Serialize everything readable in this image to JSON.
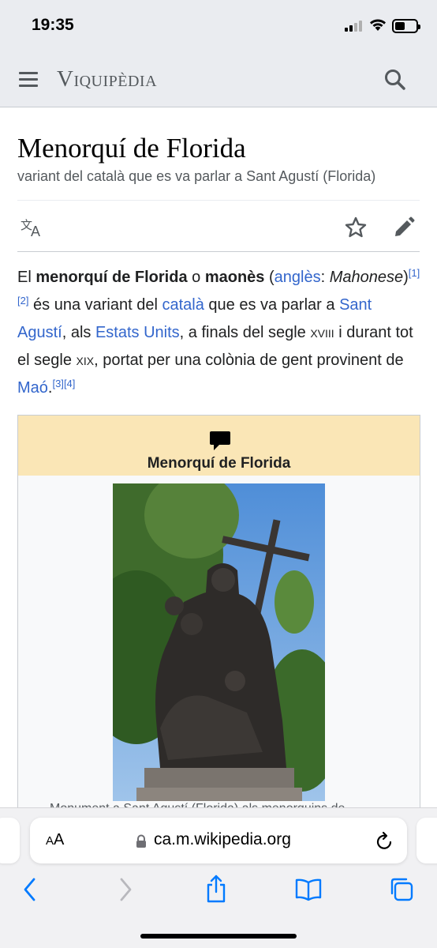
{
  "status": {
    "time": "19:35"
  },
  "header": {
    "logo": "Viquipèdia",
    "menu_icon": "hamburger-icon",
    "search_icon": "search-icon"
  },
  "article": {
    "title": "Menorquí de Florida",
    "subtitle": "variant del català que es va parlar a Sant Agustí (Florida)",
    "actions": {
      "language_icon": "translate-icon",
      "watch_icon": "star-icon",
      "edit_icon": "pencil-icon"
    },
    "lead": {
      "t1": "El ",
      "b1": "menorquí de Florida",
      "t2": " o ",
      "b2": "maonès",
      "t3": " (",
      "l1": "anglès",
      "t4": ": ",
      "i1": "Mahonese",
      "t5": ")",
      "ref1": "[1]",
      "ref2": "[2]",
      "t6": " és una variant del ",
      "l2": "català",
      "t7": " que es va parlar a ",
      "l3": "Sant Agustí",
      "t8": ", als ",
      "l4": "Estats Units",
      "t9": ", a finals del segle ",
      "sc1": "xviii",
      "t10": " i durant tot el segle ",
      "sc2": "xix",
      "t11": ", portat per una colònia de gent provinent de ",
      "l5": "Maó",
      "t12": ".",
      "ref3": "[3]",
      "ref4": "[4]"
    },
    "infobox": {
      "icon": "speech-bubble-icon",
      "title": "Menorquí de Florida",
      "header_color": "#fae6b6",
      "caption_partial": "Monument a Sant Agustí (Florida) als menorquins de"
    }
  },
  "browser": {
    "aa_label_small": "A",
    "aa_label_large": "A",
    "url": "ca.m.wikipedia.org",
    "nav": [
      "back-icon",
      "forward-icon",
      "share-icon",
      "bookmarks-icon",
      "tabs-icon"
    ]
  },
  "colors": {
    "link": "#3366cc",
    "header_bg": "#eaecf0",
    "accent_ios": "#007aff"
  }
}
